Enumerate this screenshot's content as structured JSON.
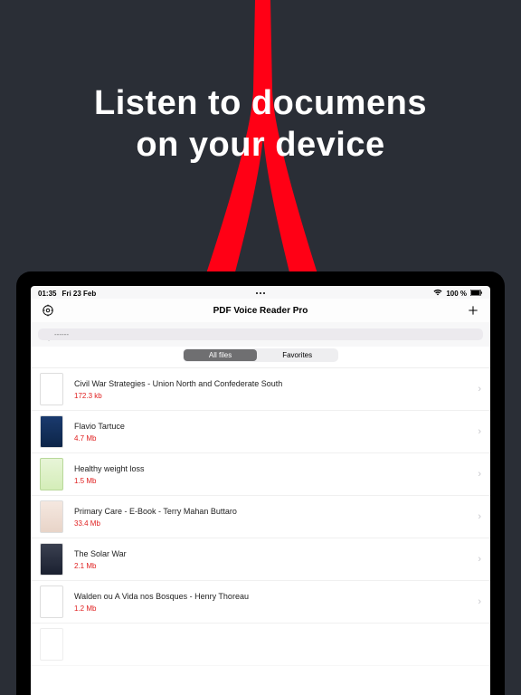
{
  "hero": {
    "line1": "Listen to documens",
    "line2": "on your device"
  },
  "statusbar": {
    "time": "01:35",
    "date": "Fri 23 Feb",
    "battery": "100 %"
  },
  "navbar": {
    "title": "PDF Voice Reader Pro"
  },
  "search": {
    "placeholder": "------"
  },
  "segment": {
    "all": "All files",
    "favorites": "Favorites"
  },
  "files": [
    {
      "name": "Civil War Strategies - Union North and Confederate South",
      "size": "172.3 kb",
      "thumb": "plain"
    },
    {
      "name": "Flavio Tartuce",
      "size": "4.7 Mb",
      "thumb": "blue"
    },
    {
      "name": "Healthy weight loss",
      "size": "1.5 Mb",
      "thumb": "green"
    },
    {
      "name": "Primary Care - E-Book - Terry Mahan Buttaro",
      "size": "33.4 Mb",
      "thumb": "pink"
    },
    {
      "name": "The Solar War",
      "size": "2.1 Mb",
      "thumb": "dark"
    },
    {
      "name": "Walden ou A Vida nos Bosques - Henry Thoreau",
      "size": "1.2 Mb",
      "thumb": "plain"
    }
  ]
}
